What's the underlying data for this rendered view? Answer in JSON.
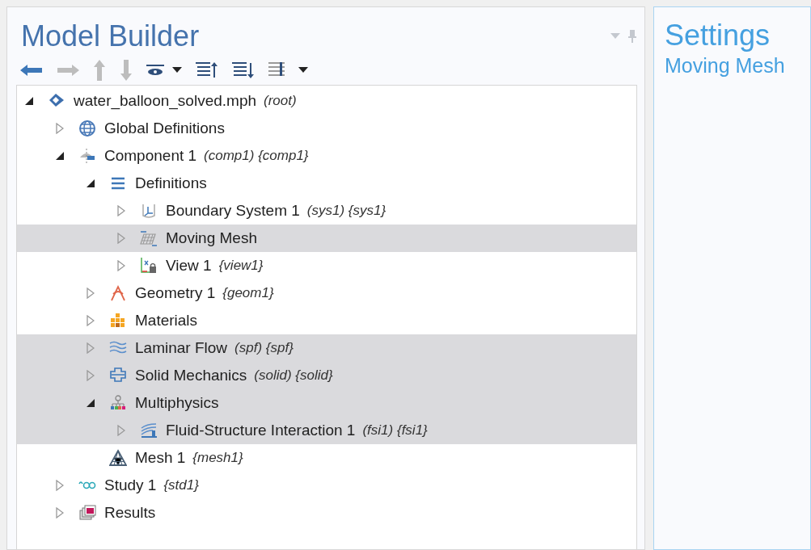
{
  "model_builder": {
    "title": "Model Builder",
    "tree": [
      {
        "label": "water_balloon_solved.mph",
        "tag": "(root)",
        "expanded": true,
        "highlighted": false,
        "children": [
          {
            "label": "Global Definitions",
            "expanded": false,
            "highlighted": false
          },
          {
            "label": "Component 1",
            "tag": "(comp1) {comp1}",
            "expanded": true,
            "highlighted": false,
            "children": [
              {
                "label": "Definitions",
                "expanded": true,
                "highlighted": false,
                "children": [
                  {
                    "label": "Boundary System 1",
                    "tag": "(sys1) {sys1}",
                    "expanded": false,
                    "highlighted": false
                  },
                  {
                    "label": "Moving Mesh",
                    "expanded": false,
                    "highlighted": true
                  },
                  {
                    "label": "View 1",
                    "tag": "{view1}",
                    "expanded": false,
                    "highlighted": false
                  }
                ]
              },
              {
                "label": "Geometry 1",
                "tag": "{geom1}",
                "expanded": false,
                "highlighted": false
              },
              {
                "label": "Materials",
                "expanded": false,
                "highlighted": false
              },
              {
                "label": "Laminar Flow",
                "tag": "(spf) {spf}",
                "expanded": false,
                "highlighted": true
              },
              {
                "label": "Solid Mechanics",
                "tag": "(solid) {solid}",
                "expanded": false,
                "highlighted": true
              },
              {
                "label": "Multiphysics",
                "expanded": true,
                "highlighted": true,
                "children": [
                  {
                    "label": "Fluid-Structure Interaction 1",
                    "tag": "(fsi1) {fsi1}",
                    "expanded": false,
                    "highlighted": true
                  }
                ]
              },
              {
                "label": "Mesh 1",
                "tag": "{mesh1}",
                "highlighted": false
              }
            ]
          },
          {
            "label": "Study 1",
            "tag": "{std1}",
            "expanded": false,
            "highlighted": false
          },
          {
            "label": "Results",
            "expanded": false,
            "highlighted": false
          }
        ]
      }
    ]
  },
  "settings": {
    "title": "Settings",
    "subtitle": "Moving Mesh"
  }
}
